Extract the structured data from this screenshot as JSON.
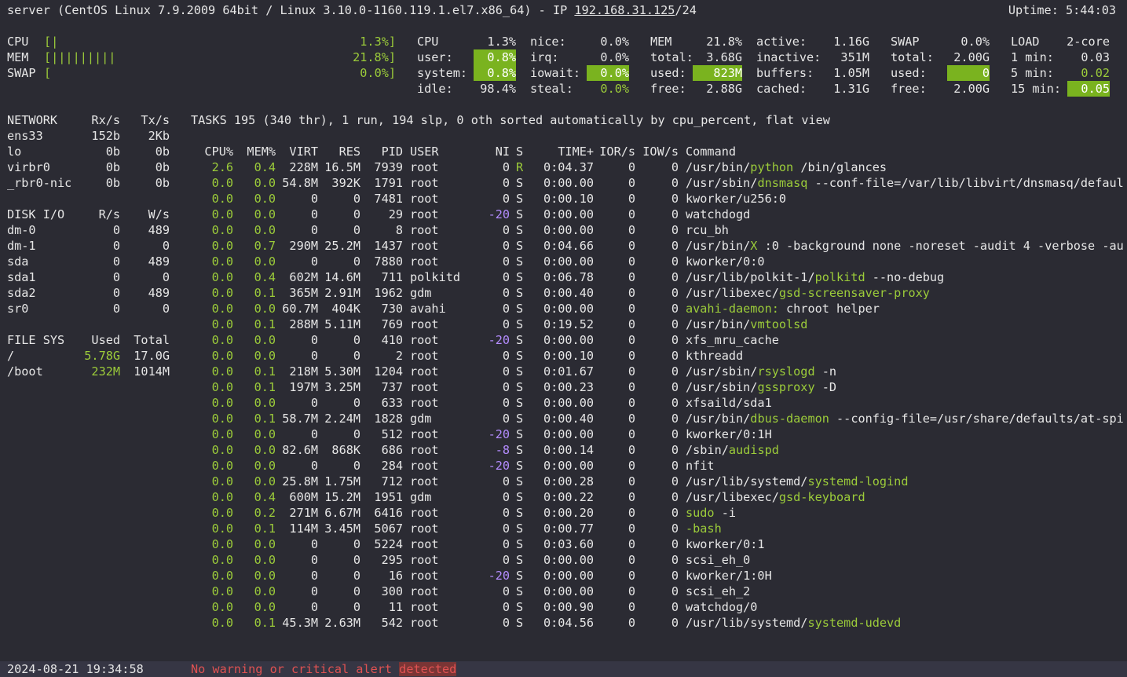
{
  "header": {
    "host": "server",
    "os": "CentOS Linux 7.9.2009 64bit / Linux 3.10.0-1160.119.1.el7.x86_64",
    "ip_label": "IP",
    "ip": "192.168.31.125",
    "mask": "/24",
    "uptime": "Uptime: 5:44:03"
  },
  "quicklook": {
    "cpu": {
      "label": "CPU",
      "bar": "[|",
      "value": "1.3%]"
    },
    "mem": {
      "label": "MEM",
      "bar": "[|||||||||",
      "value": "21.8%]"
    },
    "swap": {
      "label": "SWAP",
      "bar": "[",
      "value": "0.0%]"
    }
  },
  "cpu": {
    "title": "CPU",
    "total": "1.3%",
    "user_l": "user:",
    "user": "0.8%",
    "system_l": "system:",
    "system": "0.8%",
    "idle_l": "idle:",
    "idle": "98.4%",
    "nice_l": "nice:",
    "nice": "0.0%",
    "irq_l": "irq:",
    "irq": "0.0%",
    "iowait_l": "iowait:",
    "iowait": "0.0%",
    "steal_l": "steal:",
    "steal": "0.0%"
  },
  "mem": {
    "title": "MEM",
    "total_pct": "21.8%",
    "total_l": "total:",
    "total": "3.68G",
    "used_l": "used:",
    "used": "823M",
    "free_l": "free:",
    "free": "2.88G",
    "active_l": "active:",
    "active": "1.16G",
    "inactive_l": "inactive:",
    "inactive": "351M",
    "buffers_l": "buffers:",
    "buffers": "1.05M",
    "cached_l": "cached:",
    "cached": "1.31G"
  },
  "swap": {
    "title": "SWAP",
    "pct": "0.0%",
    "total_l": "total:",
    "total": "2.00G",
    "used_l": "used:",
    "used": "0",
    "free_l": "free:",
    "free": "2.00G"
  },
  "load": {
    "title": "LOAD",
    "cores": "2-core",
    "m1_l": "1 min:",
    "m1": "0.03",
    "m5_l": "5 min:",
    "m5": "0.02",
    "m15_l": "15 min:",
    "m15": "0.05"
  },
  "network": {
    "title": "NETWORK",
    "rx_h": "Rx/s",
    "tx_h": "Tx/s",
    "rows": [
      {
        "name": "ens33",
        "rx": "152b",
        "tx": "2Kb"
      },
      {
        "name": "lo",
        "rx": "0b",
        "tx": "0b"
      },
      {
        "name": "virbr0",
        "rx": "0b",
        "tx": "0b"
      },
      {
        "name": "_rbr0-nic",
        "rx": "0b",
        "tx": "0b"
      }
    ]
  },
  "disk": {
    "title": "DISK I/O",
    "r_h": "R/s",
    "w_h": "W/s",
    "rows": [
      {
        "name": "dm-0",
        "r": "0",
        "w": "489"
      },
      {
        "name": "dm-1",
        "r": "0",
        "w": "0"
      },
      {
        "name": "sda",
        "r": "0",
        "w": "489"
      },
      {
        "name": "sda1",
        "r": "0",
        "w": "0"
      },
      {
        "name": "sda2",
        "r": "0",
        "w": "489"
      },
      {
        "name": "sr0",
        "r": "0",
        "w": "0"
      }
    ]
  },
  "fs": {
    "title": "FILE SYS",
    "used_h": "Used",
    "total_h": "Total",
    "rows": [
      {
        "name": "/",
        "used": "5.78G",
        "total": "17.0G"
      },
      {
        "name": "/boot",
        "used": "232M",
        "total": "1014M"
      }
    ]
  },
  "tasks": {
    "l1": "TASKS",
    "n": "195",
    "thr": "(340 thr),",
    "run": "1 run,",
    "slp": "194 slp,",
    "oth": "0 oth",
    "sort": "sorted automatically by cpu_percent, flat view"
  },
  "proc_headers": {
    "cpu": "CPU%",
    "mem": "MEM%",
    "virt": "VIRT",
    "res": "RES",
    "pid": "PID",
    "user": "USER",
    "ni": "NI",
    "s": "S",
    "time": "TIME+",
    "ior": "IOR/s",
    "iow": "IOW/s",
    "cmd": "Command"
  },
  "processes": [
    {
      "cpu": "2.6",
      "mem": "0.4",
      "virt": "228M",
      "res": "16.5M",
      "pid": "7939",
      "user": "root",
      "ni": "0",
      "s": "R",
      "time": "0:04.37",
      "ior": "0",
      "iow": "0",
      "c1": "/usr/bin/",
      "c2": "python",
      "c3": " /bin/glances"
    },
    {
      "cpu": "0.0",
      "mem": "0.0",
      "virt": "54.8M",
      "res": "392K",
      "pid": "1791",
      "user": "root",
      "ni": "0",
      "s": "S",
      "time": "0:00.00",
      "ior": "0",
      "iow": "0",
      "c1": "/usr/sbin/",
      "c2": "dnsmasq",
      "c3": " --conf-file=/var/lib/libvirt/dnsmasq/defaul"
    },
    {
      "cpu": "0.0",
      "mem": "0.0",
      "virt": "0",
      "res": "0",
      "pid": "7481",
      "user": "root",
      "ni": "0",
      "s": "S",
      "time": "0:00.10",
      "ior": "0",
      "iow": "0",
      "c1": "kworker/u256:0",
      "c2": "",
      "c3": ""
    },
    {
      "cpu": "0.0",
      "mem": "0.0",
      "virt": "0",
      "res": "0",
      "pid": "29",
      "user": "root",
      "ni": "-20",
      "s": "S",
      "time": "0:00.00",
      "ior": "0",
      "iow": "0",
      "c1": "watchdogd",
      "c2": "",
      "c3": ""
    },
    {
      "cpu": "0.0",
      "mem": "0.0",
      "virt": "0",
      "res": "0",
      "pid": "8",
      "user": "root",
      "ni": "0",
      "s": "S",
      "time": "0:00.00",
      "ior": "0",
      "iow": "0",
      "c1": "rcu_bh",
      "c2": "",
      "c3": ""
    },
    {
      "cpu": "0.0",
      "mem": "0.7",
      "virt": "290M",
      "res": "25.2M",
      "pid": "1437",
      "user": "root",
      "ni": "0",
      "s": "S",
      "time": "0:04.66",
      "ior": "0",
      "iow": "0",
      "c1": "/usr/bin/",
      "c2": "X",
      "c3": " :0 -background none -noreset -audit 4 -verbose -au"
    },
    {
      "cpu": "0.0",
      "mem": "0.0",
      "virt": "0",
      "res": "0",
      "pid": "7880",
      "user": "root",
      "ni": "0",
      "s": "S",
      "time": "0:00.00",
      "ior": "0",
      "iow": "0",
      "c1": "kworker/0:0",
      "c2": "",
      "c3": ""
    },
    {
      "cpu": "0.0",
      "mem": "0.4",
      "virt": "602M",
      "res": "14.6M",
      "pid": "711",
      "user": "polkitd",
      "ni": "0",
      "s": "S",
      "time": "0:06.78",
      "ior": "0",
      "iow": "0",
      "c1": "/usr/lib/polkit-1/",
      "c2": "polkitd",
      "c3": " --no-debug"
    },
    {
      "cpu": "0.0",
      "mem": "0.1",
      "virt": "365M",
      "res": "2.91M",
      "pid": "1962",
      "user": "gdm",
      "ni": "0",
      "s": "S",
      "time": "0:00.40",
      "ior": "0",
      "iow": "0",
      "c1": "/usr/libexec/",
      "c2": "gsd-screensaver-proxy",
      "c3": ""
    },
    {
      "cpu": "0.0",
      "mem": "0.0",
      "virt": "60.7M",
      "res": "404K",
      "pid": "730",
      "user": "avahi",
      "ni": "0",
      "s": "S",
      "time": "0:00.00",
      "ior": "0",
      "iow": "0",
      "c1": "",
      "c2": "avahi-daemon:",
      "c3": " chroot helper"
    },
    {
      "cpu": "0.0",
      "mem": "0.1",
      "virt": "288M",
      "res": "5.11M",
      "pid": "769",
      "user": "root",
      "ni": "0",
      "s": "S",
      "time": "0:19.52",
      "ior": "0",
      "iow": "0",
      "c1": "/usr/bin/",
      "c2": "vmtoolsd",
      "c3": ""
    },
    {
      "cpu": "0.0",
      "mem": "0.0",
      "virt": "0",
      "res": "0",
      "pid": "410",
      "user": "root",
      "ni": "-20",
      "s": "S",
      "time": "0:00.00",
      "ior": "0",
      "iow": "0",
      "c1": "xfs_mru_cache",
      "c2": "",
      "c3": ""
    },
    {
      "cpu": "0.0",
      "mem": "0.0",
      "virt": "0",
      "res": "0",
      "pid": "2",
      "user": "root",
      "ni": "0",
      "s": "S",
      "time": "0:00.10",
      "ior": "0",
      "iow": "0",
      "c1": "kthreadd",
      "c2": "",
      "c3": ""
    },
    {
      "cpu": "0.0",
      "mem": "0.1",
      "virt": "218M",
      "res": "5.30M",
      "pid": "1204",
      "user": "root",
      "ni": "0",
      "s": "S",
      "time": "0:01.67",
      "ior": "0",
      "iow": "0",
      "c1": "/usr/sbin/",
      "c2": "rsyslogd",
      "c3": " -n"
    },
    {
      "cpu": "0.0",
      "mem": "0.1",
      "virt": "197M",
      "res": "3.25M",
      "pid": "737",
      "user": "root",
      "ni": "0",
      "s": "S",
      "time": "0:00.23",
      "ior": "0",
      "iow": "0",
      "c1": "/usr/sbin/",
      "c2": "gssproxy",
      "c3": " -D"
    },
    {
      "cpu": "0.0",
      "mem": "0.0",
      "virt": "0",
      "res": "0",
      "pid": "633",
      "user": "root",
      "ni": "0",
      "s": "S",
      "time": "0:00.00",
      "ior": "0",
      "iow": "0",
      "c1": "xfsaild/sda1",
      "c2": "",
      "c3": ""
    },
    {
      "cpu": "0.0",
      "mem": "0.1",
      "virt": "58.7M",
      "res": "2.24M",
      "pid": "1828",
      "user": "gdm",
      "ni": "0",
      "s": "S",
      "time": "0:00.40",
      "ior": "0",
      "iow": "0",
      "c1": "/usr/bin/",
      "c2": "dbus-daemon",
      "c3": " --config-file=/usr/share/defaults/at-spi"
    },
    {
      "cpu": "0.0",
      "mem": "0.0",
      "virt": "0",
      "res": "0",
      "pid": "512",
      "user": "root",
      "ni": "-20",
      "s": "S",
      "time": "0:00.00",
      "ior": "0",
      "iow": "0",
      "c1": "kworker/0:1H",
      "c2": "",
      "c3": ""
    },
    {
      "cpu": "0.0",
      "mem": "0.0",
      "virt": "82.6M",
      "res": "868K",
      "pid": "686",
      "user": "root",
      "ni": "-8",
      "s": "S",
      "time": "0:00.14",
      "ior": "0",
      "iow": "0",
      "c1": "/sbin/",
      "c2": "audispd",
      "c3": ""
    },
    {
      "cpu": "0.0",
      "mem": "0.0",
      "virt": "0",
      "res": "0",
      "pid": "284",
      "user": "root",
      "ni": "-20",
      "s": "S",
      "time": "0:00.00",
      "ior": "0",
      "iow": "0",
      "c1": "nfit",
      "c2": "",
      "c3": ""
    },
    {
      "cpu": "0.0",
      "mem": "0.0",
      "virt": "25.8M",
      "res": "1.75M",
      "pid": "712",
      "user": "root",
      "ni": "0",
      "s": "S",
      "time": "0:00.28",
      "ior": "0",
      "iow": "0",
      "c1": "/usr/lib/systemd/",
      "c2": "systemd-logind",
      "c3": ""
    },
    {
      "cpu": "0.0",
      "mem": "0.4",
      "virt": "600M",
      "res": "15.2M",
      "pid": "1951",
      "user": "gdm",
      "ni": "0",
      "s": "S",
      "time": "0:00.22",
      "ior": "0",
      "iow": "0",
      "c1": "/usr/libexec/",
      "c2": "gsd-keyboard",
      "c3": ""
    },
    {
      "cpu": "0.0",
      "mem": "0.2",
      "virt": "271M",
      "res": "6.67M",
      "pid": "6416",
      "user": "root",
      "ni": "0",
      "s": "S",
      "time": "0:00.20",
      "ior": "0",
      "iow": "0",
      "c1": "",
      "c2": "sudo",
      "c3": " -i"
    },
    {
      "cpu": "0.0",
      "mem": "0.1",
      "virt": "114M",
      "res": "3.45M",
      "pid": "5067",
      "user": "root",
      "ni": "0",
      "s": "S",
      "time": "0:00.77",
      "ior": "0",
      "iow": "0",
      "c1": "",
      "c2": "-bash",
      "c3": ""
    },
    {
      "cpu": "0.0",
      "mem": "0.0",
      "virt": "0",
      "res": "0",
      "pid": "5224",
      "user": "root",
      "ni": "0",
      "s": "S",
      "time": "0:03.60",
      "ior": "0",
      "iow": "0",
      "c1": "kworker/0:1",
      "c2": "",
      "c3": ""
    },
    {
      "cpu": "0.0",
      "mem": "0.0",
      "virt": "0",
      "res": "0",
      "pid": "295",
      "user": "root",
      "ni": "0",
      "s": "S",
      "time": "0:00.00",
      "ior": "0",
      "iow": "0",
      "c1": "scsi_eh_0",
      "c2": "",
      "c3": ""
    },
    {
      "cpu": "0.0",
      "mem": "0.0",
      "virt": "0",
      "res": "0",
      "pid": "16",
      "user": "root",
      "ni": "-20",
      "s": "S",
      "time": "0:00.00",
      "ior": "0",
      "iow": "0",
      "c1": "kworker/1:0H",
      "c2": "",
      "c3": ""
    },
    {
      "cpu": "0.0",
      "mem": "0.0",
      "virt": "0",
      "res": "0",
      "pid": "300",
      "user": "root",
      "ni": "0",
      "s": "S",
      "time": "0:00.00",
      "ior": "0",
      "iow": "0",
      "c1": "scsi_eh_2",
      "c2": "",
      "c3": ""
    },
    {
      "cpu": "0.0",
      "mem": "0.0",
      "virt": "0",
      "res": "0",
      "pid": "11",
      "user": "root",
      "ni": "0",
      "s": "S",
      "time": "0:00.90",
      "ior": "0",
      "iow": "0",
      "c1": "watchdog/0",
      "c2": "",
      "c3": ""
    },
    {
      "cpu": "0.0",
      "mem": "0.1",
      "virt": "45.3M",
      "res": "2.63M",
      "pid": "542",
      "user": "root",
      "ni": "0",
      "s": "S",
      "time": "0:04.56",
      "ior": "0",
      "iow": "0",
      "c1": "/usr/lib/systemd/",
      "c2": "systemd-udevd",
      "c3": ""
    }
  ],
  "footer": {
    "datetime": "2024-08-21 19:34:58",
    "alert_a": "No warning or critical alert ",
    "alert_b": "detected"
  },
  "colors": {
    "background": "#2b2b33",
    "text": "#e6e6e6",
    "ok": "#9ccc3a",
    "ok_bg": "#7ab31f",
    "nice": "#b48cff",
    "alert": "#e05252"
  }
}
